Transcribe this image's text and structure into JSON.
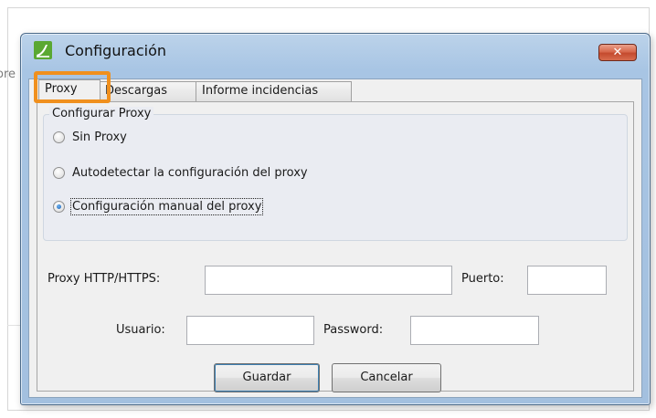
{
  "background": {
    "fragment": "ore"
  },
  "window": {
    "title": "Configuración",
    "close_label": "✕"
  },
  "tabs": [
    {
      "label": "Proxy",
      "active": true
    },
    {
      "label": "Descargas",
      "active": false
    },
    {
      "label": "Informe incidencias",
      "active": false
    }
  ],
  "proxy_group": {
    "legend": "Configurar Proxy",
    "options": [
      {
        "label": "Sin Proxy",
        "checked": false
      },
      {
        "label": "Autodetectar la configuración del proxy",
        "checked": false
      },
      {
        "label": "Configuración manual del proxy",
        "checked": true
      }
    ]
  },
  "fields": {
    "proxy_label": "Proxy HTTP/HTTPS:",
    "proxy_value": "",
    "port_label": "Puerto:",
    "port_value": "",
    "user_label": "Usuario:",
    "user_value": "",
    "password_label": "Password:",
    "password_value": ""
  },
  "buttons": {
    "save": "Guardar",
    "cancel": "Cancelar"
  },
  "colors": {
    "highlight": "#f0901e",
    "title_gradient": "#a8c5e4",
    "close_button": "#c44a2e"
  }
}
